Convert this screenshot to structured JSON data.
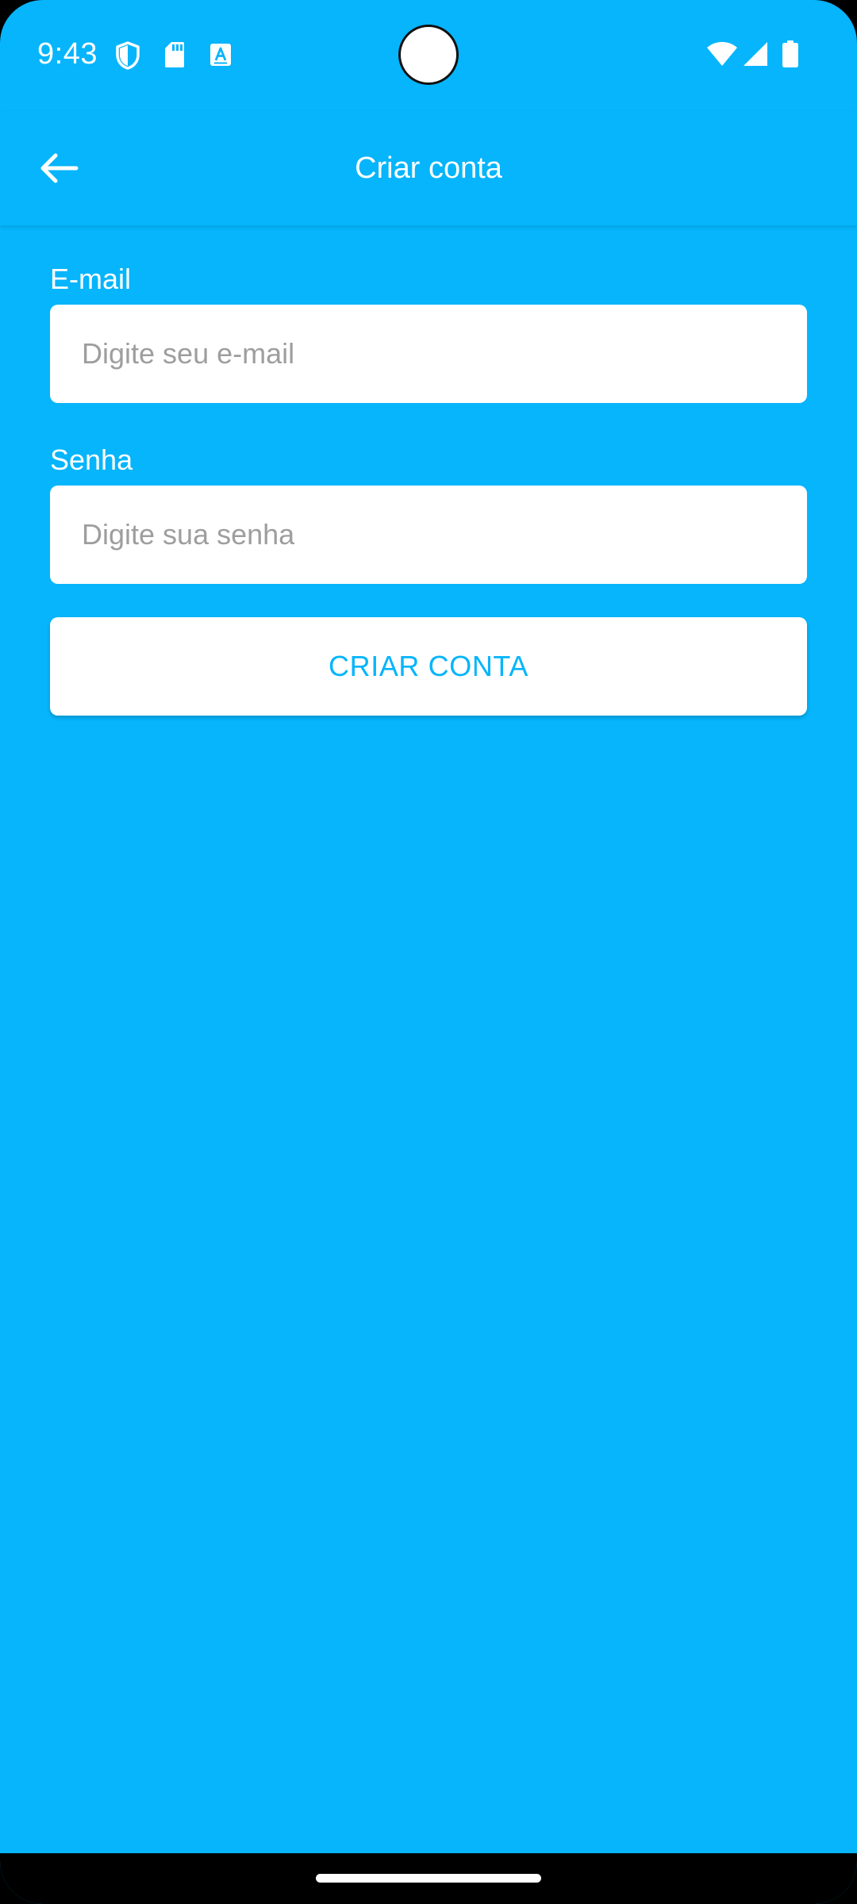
{
  "status_bar": {
    "time": "9:43",
    "left_icons": [
      "shield-icon",
      "sd-card-icon",
      "font-a-icon"
    ],
    "right_icons": [
      "wifi-icon",
      "cell-signal-icon",
      "battery-icon"
    ]
  },
  "app_bar": {
    "title": "Criar conta",
    "back_icon": "arrow-left-icon"
  },
  "form": {
    "email": {
      "label": "E-mail",
      "placeholder": "Digite seu e-mail",
      "value": ""
    },
    "password": {
      "label": "Senha",
      "placeholder": "Digite sua senha",
      "value": ""
    },
    "submit_label": "CRIAR CONTA"
  },
  "colors": {
    "background": "#06b5fb",
    "accent": "#06b5fb",
    "surface": "#ffffff",
    "placeholder": "#9e9e9e",
    "nav_bar": "#000000"
  }
}
